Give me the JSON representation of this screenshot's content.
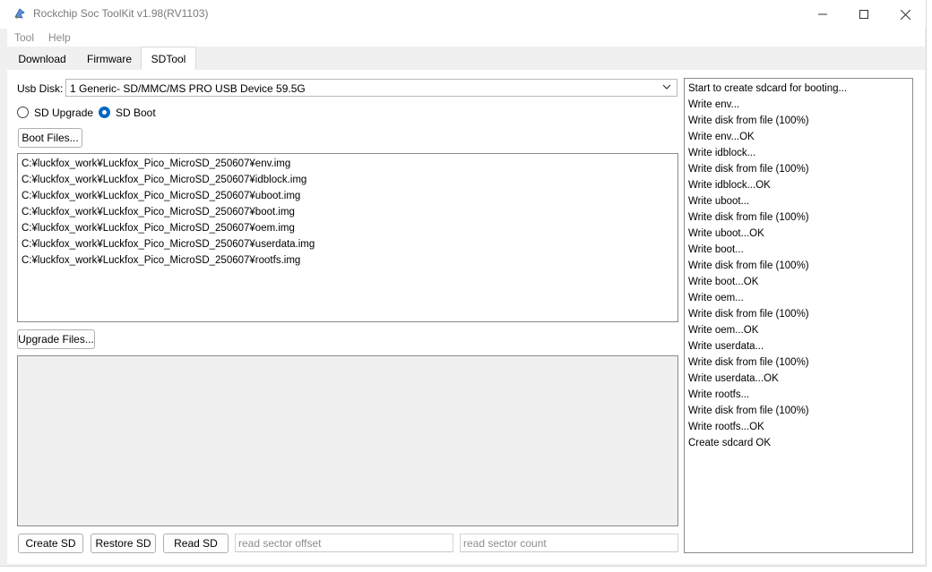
{
  "window": {
    "title": "Rockchip Soc ToolKit v1.98(RV1103)",
    "controls": [
      "minimize",
      "maximize",
      "close"
    ]
  },
  "menu": [
    "Tool",
    "Help"
  ],
  "tabs": [
    {
      "label": "Download",
      "active": false
    },
    {
      "label": "Firmware",
      "active": false
    },
    {
      "label": "SDTool",
      "active": true
    }
  ],
  "sdtool": {
    "usb_disk_label": "Usb Disk:",
    "usb_disk_value": "1 Generic- SD/MMC/MS PRO USB Device 59.5G",
    "mode_options": [
      {
        "label": "SD Upgrade",
        "selected": false
      },
      {
        "label": "SD Boot",
        "selected": true
      }
    ],
    "boot_files_button": "Boot Files...",
    "boot_files": [
      "C:¥luckfox_work¥Luckfox_Pico_MicroSD_250607¥env.img",
      "C:¥luckfox_work¥Luckfox_Pico_MicroSD_250607¥idblock.img",
      "C:¥luckfox_work¥Luckfox_Pico_MicroSD_250607¥uboot.img",
      "C:¥luckfox_work¥Luckfox_Pico_MicroSD_250607¥boot.img",
      "C:¥luckfox_work¥Luckfox_Pico_MicroSD_250607¥oem.img",
      "C:¥luckfox_work¥Luckfox_Pico_MicroSD_250607¥userdata.img",
      "C:¥luckfox_work¥Luckfox_Pico_MicroSD_250607¥rootfs.img"
    ],
    "upgrade_files_button": "Upgrade Files...",
    "buttons": {
      "create": "Create SD",
      "restore": "Restore SD",
      "read": "Read SD"
    },
    "read_sector_offset_placeholder": "read sector offset",
    "read_sector_count_placeholder": "read sector count"
  },
  "log": [
    "Start to create sdcard for booting...",
    "Write env...",
    "Write disk from file (100%)",
    "Write env...OK",
    "Write idblock...",
    "Write disk from file (100%)",
    "Write idblock...OK",
    "Write uboot...",
    "Write disk from file (100%)",
    "Write uboot...OK",
    "Write boot...",
    "Write disk from file (100%)",
    "Write boot...OK",
    "Write oem...",
    "Write disk from file (100%)",
    "Write oem...OK",
    "Write userdata...",
    "Write disk from file (100%)",
    "Write userdata...OK",
    "Write rootfs...",
    "Write disk from file (100%)",
    "Write rootfs...OK",
    "Create sdcard OK"
  ],
  "colors": {
    "accent": "#0067c0",
    "window_bg": "#f0f0f0",
    "panel_bg": "#ffffff"
  }
}
